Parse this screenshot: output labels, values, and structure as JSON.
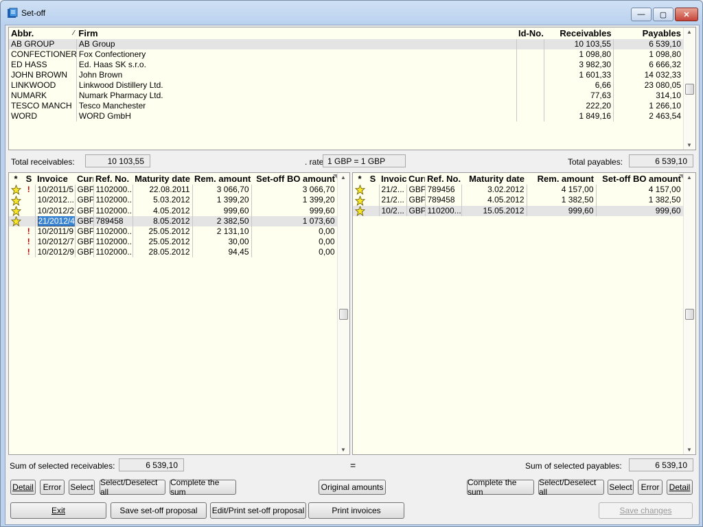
{
  "window": {
    "title": "Set-off",
    "min_label": "—",
    "max_label": "▢",
    "close_label": "✕"
  },
  "firms": {
    "columns": [
      "Abbr.",
      "Firm",
      "Id-No.",
      "Receivables",
      "Payables"
    ],
    "sort_mark": "⁄",
    "rows": [
      {
        "abbr": "AB GROUP",
        "firm": "AB Group",
        "id": "",
        "rec": "10 103,55",
        "pay": "6 539,10"
      },
      {
        "abbr": "CONFECTIONERY",
        "firm": "Fox Confectionery",
        "id": "",
        "rec": "1 098,80",
        "pay": "1 098,80"
      },
      {
        "abbr": "ED HASS",
        "firm": "Ed. Haas SK s.r.o.",
        "id": "",
        "rec": "3 982,30",
        "pay": "6 666,32"
      },
      {
        "abbr": "JOHN BROWN",
        "firm": "John Brown",
        "id": "",
        "rec": "1 601,33",
        "pay": "14 032,33"
      },
      {
        "abbr": "LINKWOOD",
        "firm": "Linkwood Distillery Ltd.",
        "id": "",
        "rec": "6,66",
        "pay": "23 080,05"
      },
      {
        "abbr": "NUMARK",
        "firm": "Numark Pharmacy Ltd.",
        "id": "",
        "rec": "77,63",
        "pay": "314,10"
      },
      {
        "abbr": "TESCO MANCH",
        "firm": "Tesco Manchester",
        "id": "",
        "rec": "222,20",
        "pay": "1 266,10"
      },
      {
        "abbr": "WORD",
        "firm": "WORD GmbH",
        "id": "",
        "rec": "1 849,16",
        "pay": "2 463,54"
      }
    ]
  },
  "totals": {
    "receivables_label": "Total receivables:",
    "receivables_value": "10 103,55",
    "rate_label": ". rate",
    "rate_value": "1 GBP = 1 GBP",
    "payables_label": "Total payables:",
    "payables_value": "6 539,10"
  },
  "left": {
    "columns": [
      "*",
      "S",
      "Invoice",
      "Curr",
      "Ref. No.",
      "Maturity date",
      "Rem. amount",
      "Set-off BO amount"
    ],
    "rows": [
      {
        "star": true,
        "warn": "!",
        "inv": "10/2011/5",
        "cur": "GBP",
        "ref": "1102000...",
        "mat": "22.08.2011",
        "rem": "3 066,70",
        "set": "3 066,70"
      },
      {
        "star": true,
        "warn": "",
        "inv": "10/2012...",
        "cur": "GBP",
        "ref": "1102000...",
        "mat": "5.03.2012",
        "rem": "1 399,20",
        "set": "1 399,20"
      },
      {
        "star": true,
        "warn": "",
        "inv": "10/2012/2",
        "cur": "GBP",
        "ref": "1102000...",
        "mat": "4.05.2012",
        "rem": "999,60",
        "set": "999,60"
      },
      {
        "star": true,
        "warn": "",
        "inv": "21/2012/4",
        "cur": "GBP",
        "ref": "789458",
        "mat": "8.05.2012",
        "rem": "2 382,50",
        "set": "1 073,60"
      },
      {
        "star": false,
        "warn": "!",
        "inv": "10/2011/9",
        "cur": "GBP",
        "ref": "1102000...",
        "mat": "25.05.2012",
        "rem": "2 131,10",
        "set": "0,00"
      },
      {
        "star": false,
        "warn": "!",
        "inv": "10/2012/7",
        "cur": "GBP",
        "ref": "1102000...",
        "mat": "25.05.2012",
        "rem": "30,00",
        "set": "0,00"
      },
      {
        "star": false,
        "warn": "!",
        "inv": "10/2012/9",
        "cur": "GBP",
        "ref": "1102000...",
        "mat": "28.05.2012",
        "rem": "94,45",
        "set": "0,00"
      }
    ]
  },
  "right": {
    "columns": [
      "*",
      "S",
      "Invoice",
      "Curr",
      "Ref. No.",
      "Maturity date",
      "Rem. amount",
      "Set-off BO amount"
    ],
    "rows": [
      {
        "star": true,
        "warn": "",
        "inv": "21/2...",
        "cur": "GBP",
        "ref": "789456",
        "mat": "3.02.2012",
        "rem": "4 157,00",
        "set": "4 157,00"
      },
      {
        "star": true,
        "warn": "",
        "inv": "21/2...",
        "cur": "GBP",
        "ref": "789458",
        "mat": "4.05.2012",
        "rem": "1 382,50",
        "set": "1 382,50"
      },
      {
        "star": true,
        "warn": "",
        "inv": "10/2...",
        "cur": "GBP",
        "ref": "110200...",
        "mat": "15.05.2012",
        "rem": "999,60",
        "set": "999,60"
      }
    ]
  },
  "sums": {
    "rec_label": "Sum of selected receivables:",
    "rec_value": "6 539,10",
    "eq": "=",
    "pay_label": "Sum of selected payables:",
    "pay_value": "6 539,10"
  },
  "buttons_row1": {
    "detail": "Detail",
    "error": "Error",
    "select": "Select",
    "select_all": "Select/Deselect all",
    "complete": "Complete the sum",
    "original": "Original amounts",
    "complete_r": "Complete the sum",
    "select_all_r": "Select/Deselect all",
    "select_r": "Select",
    "error_r": "Error",
    "detail_r": "Detail"
  },
  "buttons_row2": {
    "exit": "Exit",
    "save_proposal": "Save set-off proposal",
    "edit_print": "Edit/Print set-off proposal",
    "print_invoices": "Print invoices",
    "save_changes": "Save changes"
  }
}
